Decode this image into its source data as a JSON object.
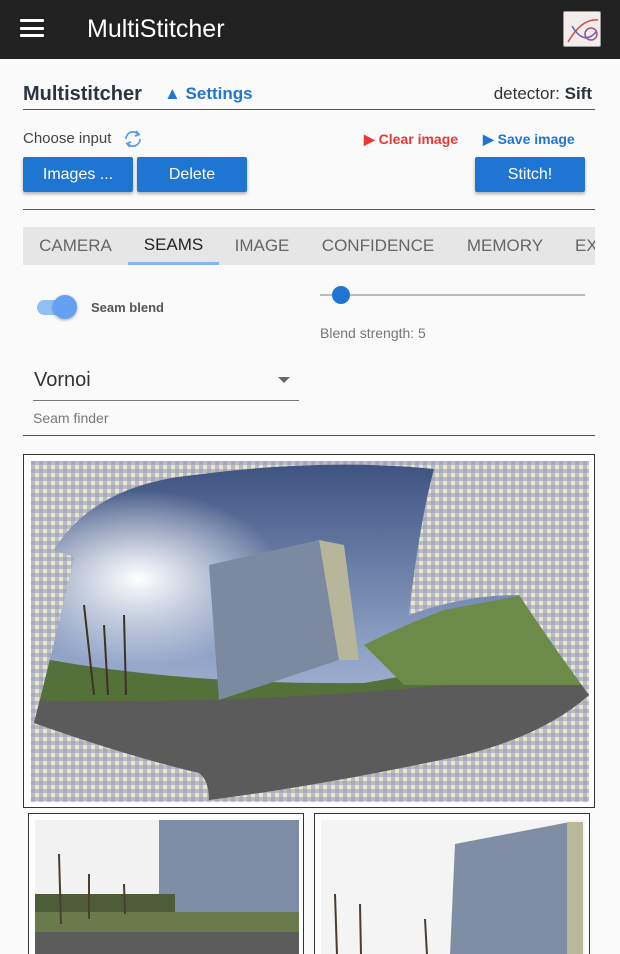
{
  "app": {
    "title": "MultiStitcher"
  },
  "header": {
    "title": "Multistitcher",
    "settings_label": "▲ Settings",
    "detector_label": "detector:",
    "detector_value": "Sift"
  },
  "input": {
    "label": "Choose input",
    "clear_label": "▶ Clear image",
    "save_label": "▶ Save image"
  },
  "buttons": {
    "images": "Images ...",
    "delete": "Delete",
    "stitch": "Stitch!"
  },
  "tabs": [
    {
      "label": "CAMERA"
    },
    {
      "label": "SEAMS"
    },
    {
      "label": "IMAGE"
    },
    {
      "label": "CONFIDENCE"
    },
    {
      "label": "MEMORY"
    },
    {
      "label": "EX"
    }
  ],
  "active_tab": "SEAMS",
  "seams": {
    "seam_blend_label": "Seam blend",
    "seam_blend_on": true,
    "blend_strength_label": "Blend strength: 5",
    "blend_strength_value": 5,
    "seam_finder_value": "Vornoi",
    "seam_finder_label": "Seam finder"
  },
  "colors": {
    "primary": "#1f76d2",
    "danger": "#e53935",
    "appbar": "#212121",
    "toggle": "#64a0f4"
  },
  "icons": {
    "menu": "menu-icon",
    "refresh": "refresh-icon",
    "logo": "app-logo-icon",
    "dropdown": "chevron-down-icon"
  }
}
